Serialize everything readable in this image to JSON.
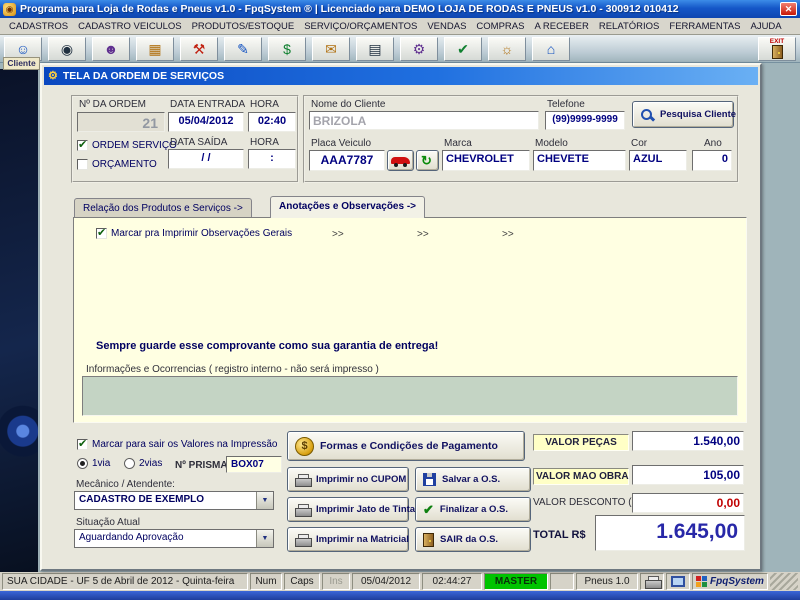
{
  "app": {
    "title": "Programa para Loja de Rodas e Pneus v1.0 - FpqSystem ® | Licenciado para  DEMO LOJA DE RODAS E PNEUS v1.0 - 300912 010412",
    "close_glyph": "✕"
  },
  "menu": {
    "items": [
      "CADASTROS",
      "CADASTRO VEICULOS",
      "PRODUTOS/ESTOQUE",
      "SERVIÇO/ORÇAMENTOS",
      "VENDAS",
      "COMPRAS",
      "A RECEBER",
      "RELATÓRIOS",
      "FERRAMENTAS",
      "AJUDA"
    ]
  },
  "toolbar": {
    "cliente_label": "Cliente",
    "exit_label": "EXIT"
  },
  "icons": {
    "app": "◉",
    "dialog": "⚙",
    "client": "☺",
    "tire": "◉",
    "supplier": "☻",
    "grid": "▦",
    "tools": "⚒",
    "edit": "✎",
    "money": "$",
    "mail": "✉",
    "report": "▤",
    "gear": "⚙",
    "sun": "☼",
    "home": "⌂",
    "check": "✔",
    "refresh": "↻",
    "chevron": "▼",
    "coin": "$"
  },
  "dialog": {
    "title": "TELA DA ORDEM DE SERVIÇOS",
    "order": {
      "num_label": "Nº DA ORDEM",
      "num_value": "21",
      "entrada_label": "DATA ENTRADA",
      "entrada_value": "05/04/2012",
      "hora_label": "HORA",
      "hora_entrada": "02:40",
      "ordem_servico_label": "ORDEM SERVIÇO",
      "orcamento_label": "ORÇAMENTO",
      "saida_label": "DATA SAÍDA",
      "saida_value": "/ /",
      "hora_saida": ":"
    },
    "client": {
      "nome_label": "Nome do Cliente",
      "nome": "BRIZOLA",
      "telefone_label": "Telefone",
      "telefone": "(99)9999-9999",
      "pesquisa_label": "Pesquisa Cliente",
      "placa_label": "Placa Veiculo",
      "placa": "AAA7787",
      "marca_label": "Marca",
      "marca": "CHEVROLET",
      "modelo_label": "Modelo",
      "modelo": "CHEVETE",
      "cor_label": "Cor",
      "cor": "AZUL",
      "ano_label": "Ano",
      "ano": "0"
    },
    "tabs": {
      "produtos": "Relação dos Produtos e Serviços ->",
      "anotacoes": "Anotações e Observações ->"
    },
    "obs": {
      "marcar_label": "Marcar pra Imprimir Observações Gerais",
      "arrow": ">>",
      "texto": "Sempre guarde esse comprovante como sua garantia de entrega!",
      "info_label": "Informações e Ocorrencias ( registro interno - não será impresso )"
    },
    "footer": {
      "valores_label": "Marcar para sair os Valores na Impressão",
      "via1": "1via",
      "via2": "2vias",
      "prisma_label": "Nº PRISMA",
      "prisma": "BOX07",
      "mecanico_label": "Mecânico / Atendente:",
      "mecanico": "CADASTRO DE EXEMPLO",
      "situacao_label": "Situação Atual",
      "situacao": "Aguardando Aprovação",
      "pagamento": "Formas e Condições de Pagamento",
      "cupom": "Imprimir no CUPOM",
      "salvar": "Salvar a O.S.",
      "jato": "Imprimir Jato de Tinta",
      "finalizar": "Finalizar a O.S.",
      "matricial": "Imprimir na Matricial",
      "sair": "SAIR da O.S."
    },
    "totals": {
      "pecas_label": "VALOR PEÇAS",
      "pecas": "1.540,00",
      "mao_label": "VALOR MAO OBRA",
      "mao": "105,00",
      "desconto_label": "VALOR DESCONTO ( - )",
      "desconto": "0,00",
      "total_label": "TOTAL R$",
      "total": "1.645,00"
    }
  },
  "statusbar": {
    "location": "SUA CIDADE - UF  5 de Abril de 2012 - Quinta-feira",
    "num": "Num",
    "caps": "Caps",
    "ins": "Ins",
    "date": "05/04/2012",
    "time": "02:44:27",
    "master": "MASTER",
    "app_name": "Pneus 1.0",
    "brand": "FpqSystem"
  },
  "colors": {
    "master_bg": "#00C400",
    "total_text": "#2828A8",
    "desconto_text": "#C00000"
  }
}
